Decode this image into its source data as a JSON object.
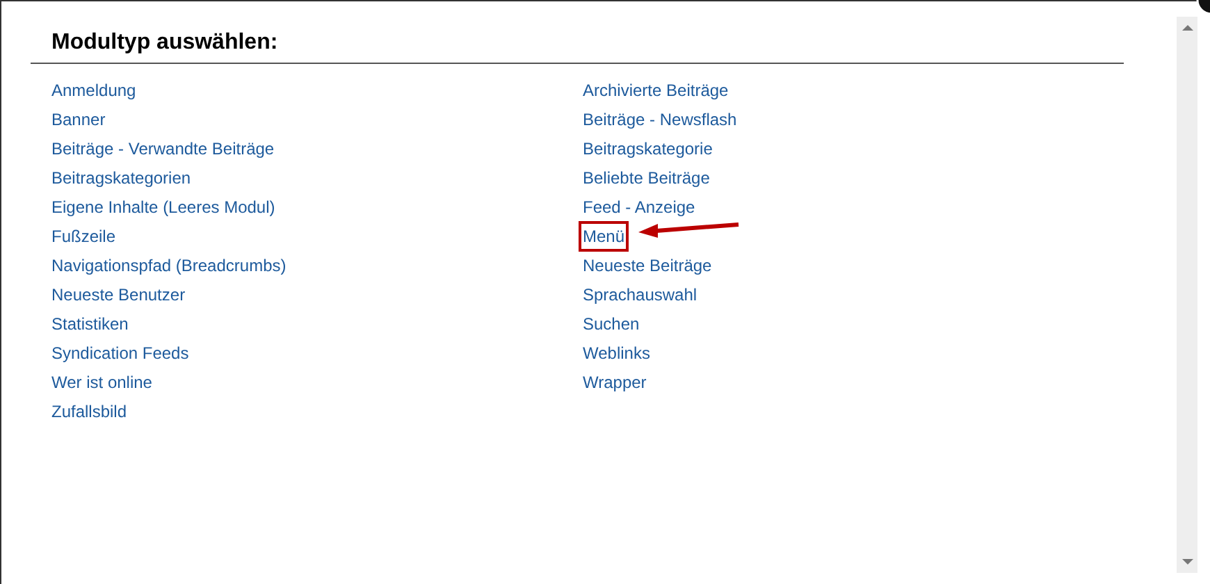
{
  "dialog": {
    "title": "Modultyp auswählen:"
  },
  "columns": [
    [
      {
        "label": "Anmeldung",
        "highlighted": false
      },
      {
        "label": "Banner",
        "highlighted": false
      },
      {
        "label": "Beiträge - Verwandte Beiträge",
        "highlighted": false
      },
      {
        "label": "Beitragskategorien",
        "highlighted": false
      },
      {
        "label": "Eigene Inhalte (Leeres Modul)",
        "highlighted": false
      },
      {
        "label": "Fußzeile",
        "highlighted": false
      },
      {
        "label": "Navigationspfad (Breadcrumbs)",
        "highlighted": false
      },
      {
        "label": "Neueste Benutzer",
        "highlighted": false
      },
      {
        "label": "Statistiken",
        "highlighted": false
      },
      {
        "label": "Syndication Feeds",
        "highlighted": false
      },
      {
        "label": "Wer ist online",
        "highlighted": false
      },
      {
        "label": "Zufallsbild",
        "highlighted": false
      }
    ],
    [
      {
        "label": "Archivierte Beiträge",
        "highlighted": false
      },
      {
        "label": "Beiträge - Newsflash",
        "highlighted": false
      },
      {
        "label": "Beitragskategorie",
        "highlighted": false
      },
      {
        "label": "Beliebte Beiträge",
        "highlighted": false
      },
      {
        "label": "Feed - Anzeige",
        "highlighted": false
      },
      {
        "label": "Menü",
        "highlighted": true
      },
      {
        "label": "Neueste Beiträge",
        "highlighted": false
      },
      {
        "label": "Sprachauswahl",
        "highlighted": false
      },
      {
        "label": "Suchen",
        "highlighted": false
      },
      {
        "label": "Weblinks",
        "highlighted": false
      },
      {
        "label": "Wrapper",
        "highlighted": false
      }
    ]
  ]
}
